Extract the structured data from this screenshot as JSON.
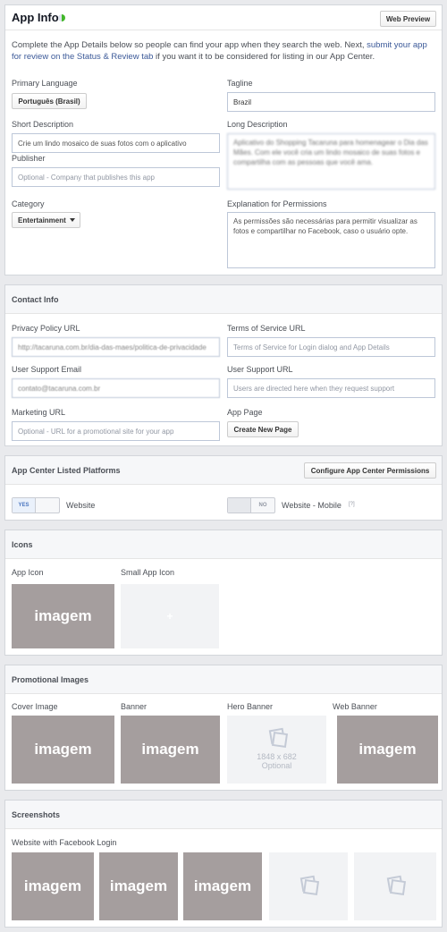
{
  "app_info": {
    "title": "App Info",
    "web_preview": "Web Preview",
    "description_pre": "Complete the App Details below so people can find your app when they search the web. Next, ",
    "description_link": "submit your app for review on the Status & Review tab",
    "description_post": " if you want it to be considered for listing in our App Center.",
    "primary_language_label": "Primary Language",
    "primary_language_value": "Português (Brasil)",
    "tagline_label": "Tagline",
    "tagline_value": "Brazil",
    "short_description_label": "Short Description",
    "short_description_value": "Crie um lindo mosaico de suas fotos com o aplicativo",
    "long_description_label": "Long Description",
    "long_description_value": "Aplicativo do Shopping Tacaruna para homenagear o Dia das Mães. Com ele você cria um lindo mosaico de suas fotos e compartilha com as pessoas que você ama.",
    "publisher_label": "Publisher",
    "publisher_placeholder": "Optional - Company that publishes this app",
    "category_label": "Category",
    "category_value": "Entertainment",
    "permissions_label": "Explanation for Permissions",
    "permissions_value": "As permissões são necessárias para permitir visualizar as fotos e compartilhar no Facebook, caso o usuário opte."
  },
  "contact_info": {
    "title": "Contact Info",
    "privacy_label": "Privacy Policy URL",
    "privacy_value": "http://tacaruna.com.br/dia-das-maes/politica-de-privacidade",
    "tos_label": "Terms of Service URL",
    "tos_placeholder": "Terms of Service for Login dialog and App Details",
    "support_email_label": "User Support Email",
    "support_email_value": "contato@tacaruna.com.br",
    "support_url_label": "User Support URL",
    "support_url_placeholder": "Users are directed here when they request support",
    "marketing_label": "Marketing URL",
    "marketing_placeholder": "Optional - URL for a promotional site for your app",
    "app_page_label": "App Page",
    "create_page_button": "Create New Page"
  },
  "platforms": {
    "title": "App Center Listed Platforms",
    "configure_button": "Configure App Center Permissions",
    "website_toggle": "YES",
    "website_label": "Website",
    "mobile_toggle": "NO",
    "mobile_label": "Website - Mobile",
    "mobile_help": "[?]"
  },
  "icons": {
    "title": "Icons",
    "app_icon_label": "App Icon",
    "app_icon_text": "imagem",
    "small_icon_label": "Small App Icon"
  },
  "promo": {
    "title": "Promotional Images",
    "cover_label": "Cover Image",
    "cover_text": "imagem",
    "banner_label": "Banner",
    "banner_text": "imagem",
    "hero_label": "Hero Banner",
    "hero_size": "1848 x 682",
    "hero_optional": "Optional",
    "web_banner_label": "Web Banner",
    "web_banner_text": "imagem"
  },
  "screenshots": {
    "title": "Screenshots",
    "website_label": "Website with Facebook Login",
    "shot1": "imagem",
    "shot2": "imagem",
    "shot3": "imagem"
  },
  "colors": {
    "link": "#3b5998",
    "status_dot": "#42b72a",
    "placeholder_image": "#a59e9e"
  }
}
